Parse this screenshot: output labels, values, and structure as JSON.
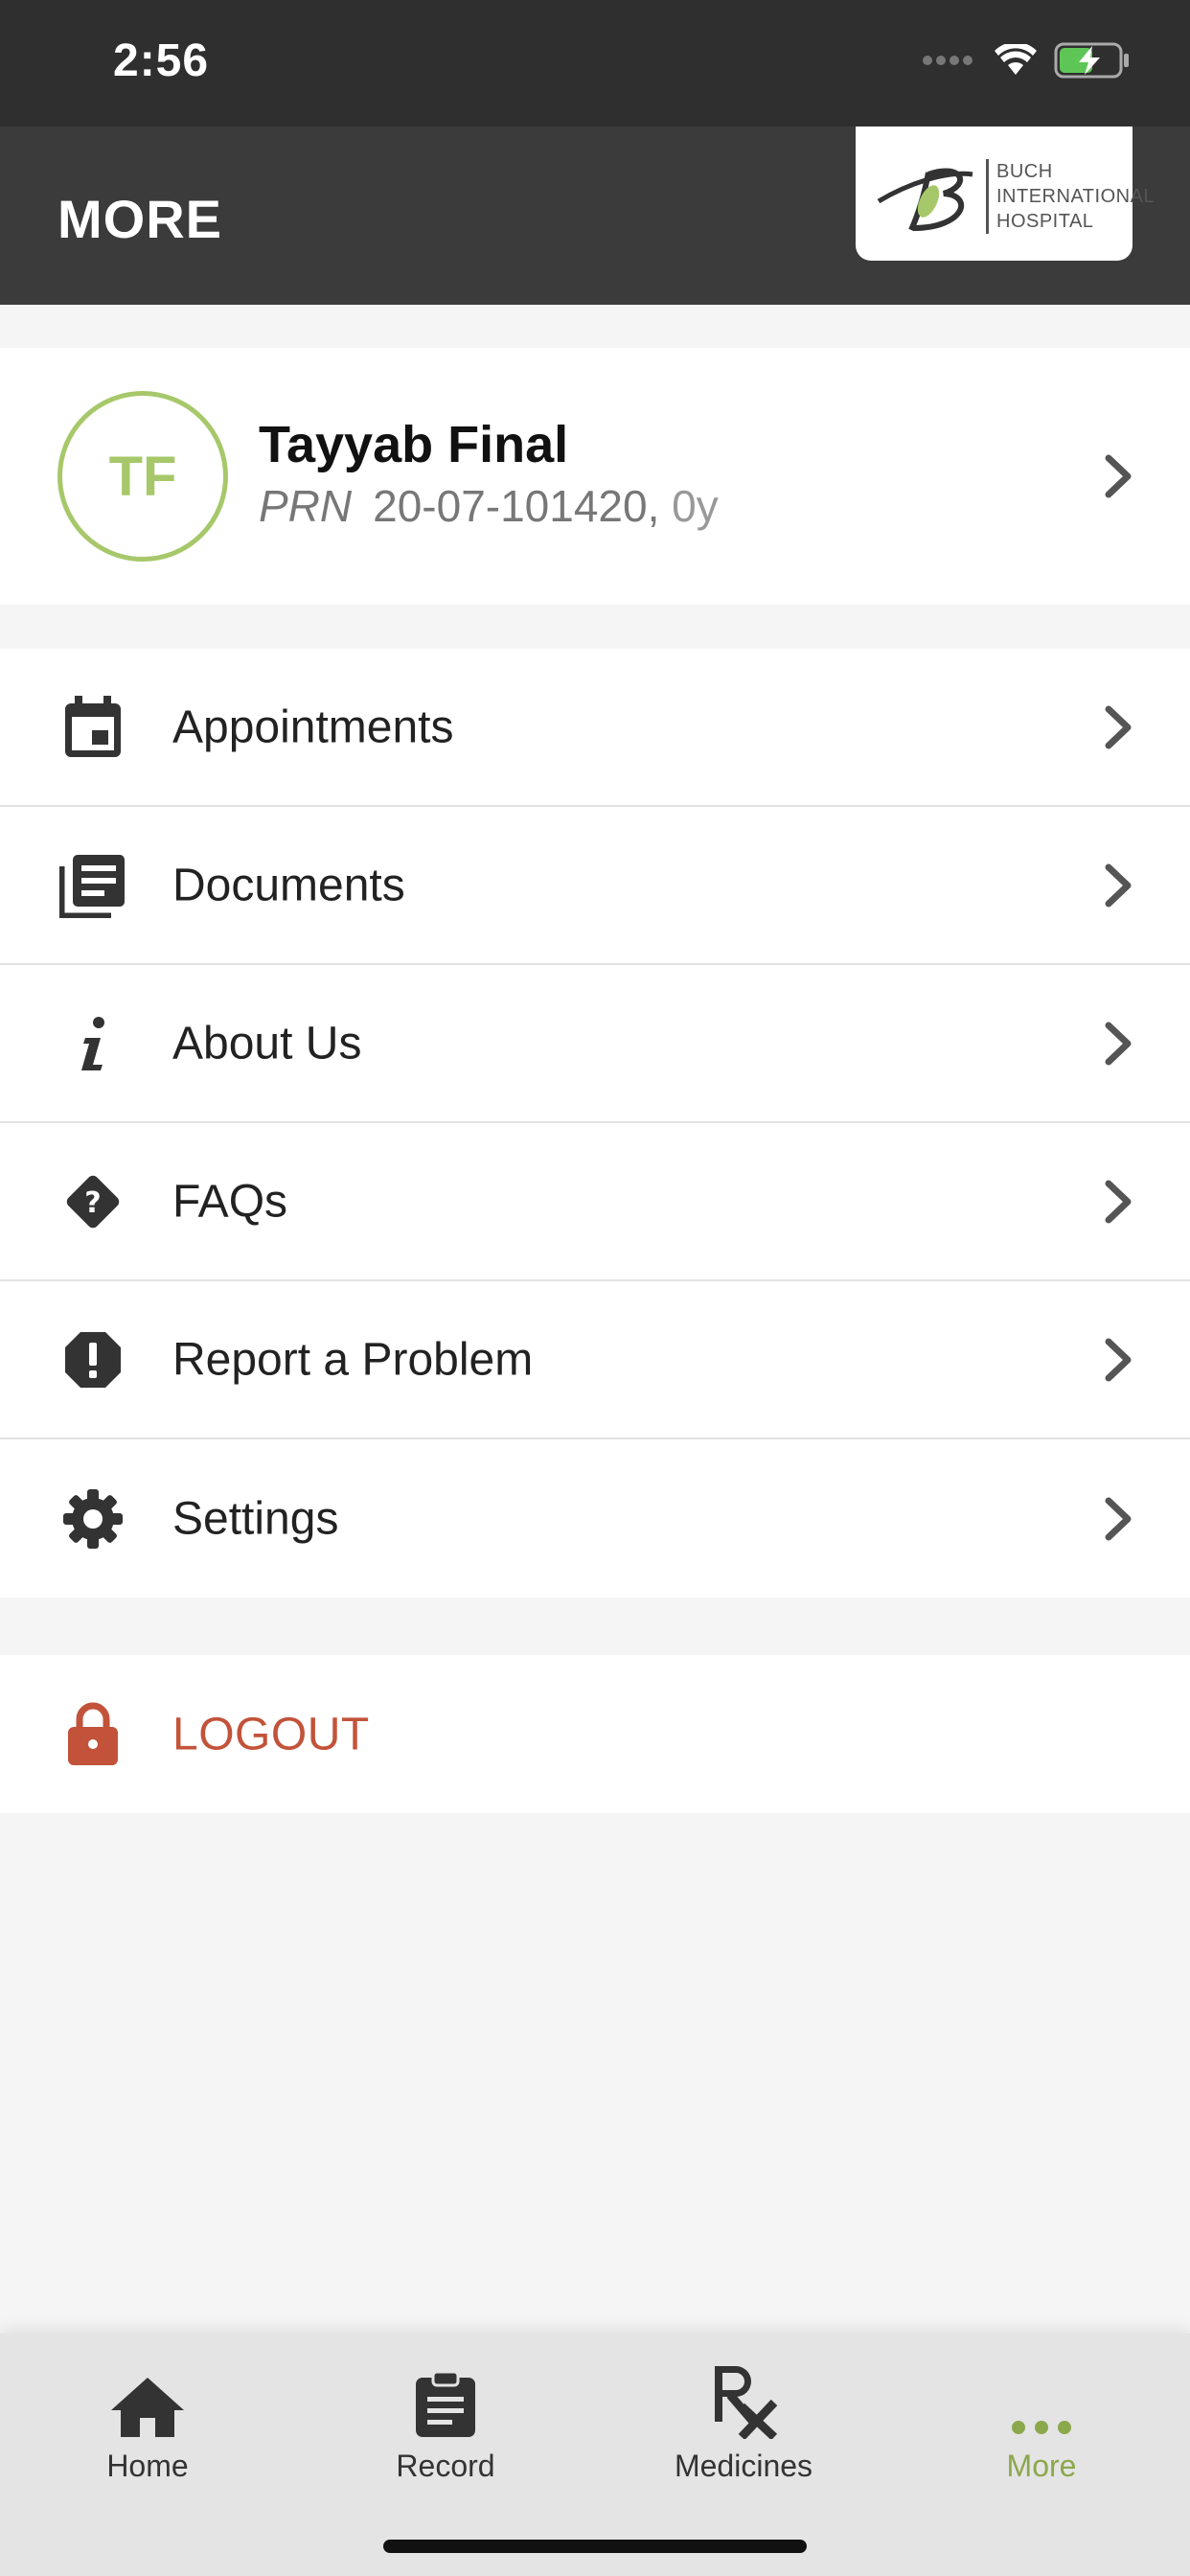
{
  "status_bar": {
    "time": "2:56"
  },
  "header": {
    "title": "MORE",
    "logo": {
      "line1": "BUCH",
      "line2": "INTERNATIONAL",
      "line3": "HOSPITAL",
      "accent_color": "#a7c86a"
    }
  },
  "profile": {
    "initials": "TF",
    "name": "Tayyab Final",
    "prn_label": "PRN",
    "prn_value": "20-07-101420,",
    "age": "0y",
    "accent_color": "#a7c86a"
  },
  "menu": {
    "items": [
      {
        "label": "Appointments",
        "icon": "calendar-icon"
      },
      {
        "label": "Documents",
        "icon": "documents-icon"
      },
      {
        "label": "About Us",
        "icon": "info-icon"
      },
      {
        "label": "FAQs",
        "icon": "question-diamond-icon"
      },
      {
        "label": "Report a Problem",
        "icon": "alert-octagon-icon"
      },
      {
        "label": "Settings",
        "icon": "gear-icon"
      }
    ]
  },
  "logout": {
    "label": "LOGOUT",
    "icon": "lock-icon",
    "color": "#c2533a"
  },
  "tabs": [
    {
      "label": "Home",
      "icon": "home-icon",
      "active": false
    },
    {
      "label": "Record",
      "icon": "clipboard-icon",
      "active": false
    },
    {
      "label": "Medicines",
      "icon": "rx-icon",
      "active": false
    },
    {
      "label": "More",
      "icon": "more-dots-icon",
      "active": true
    }
  ],
  "colors": {
    "active_tab": "#8ba84c",
    "header_bg": "#3b3b3b"
  }
}
